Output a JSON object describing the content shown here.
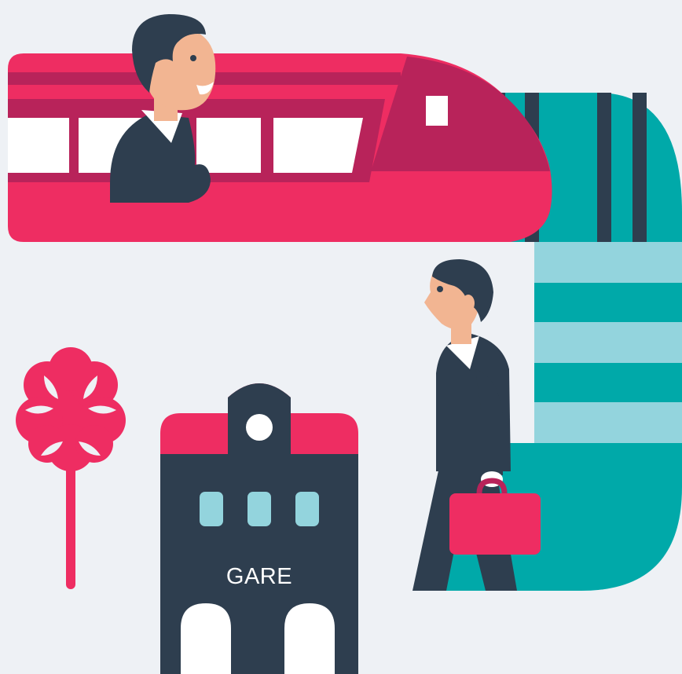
{
  "scene": {
    "station_sign": "GARE",
    "colors": {
      "background": "#eef1f5",
      "train_red": "#ee2d62",
      "train_dark_red": "#b8235a",
      "teal": "#00a9a9",
      "light_teal": "#93d4dd",
      "navy": "#2e3e4f",
      "skin": "#f2b592",
      "white": "#ffffff"
    },
    "icons": [
      "train-icon",
      "passenger-in-train",
      "walking-businessman",
      "briefcase-icon",
      "tree-icon",
      "station-building-icon"
    ]
  }
}
